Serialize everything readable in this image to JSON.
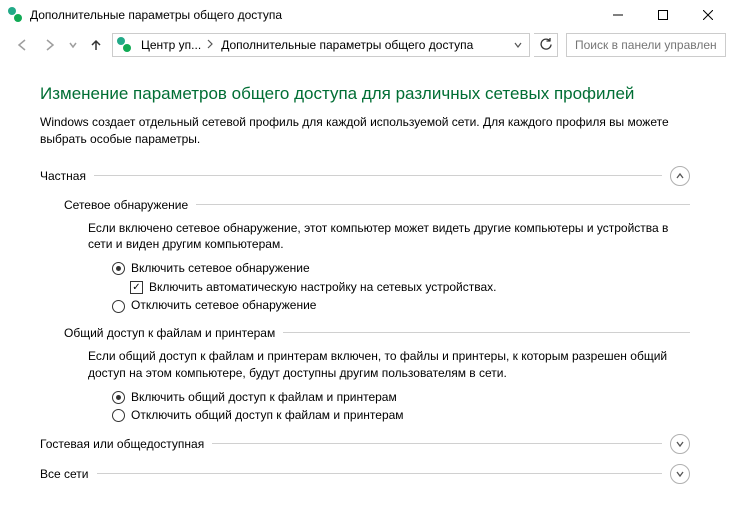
{
  "window": {
    "title": "Дополнительные параметры общего доступа"
  },
  "breadcrumb": {
    "seg1": "Центр уп...",
    "seg2": "Дополнительные параметры общего доступа"
  },
  "search": {
    "placeholder": "Поиск в панели управления"
  },
  "page": {
    "heading": "Изменение параметров общего доступа для различных сетевых профилей",
    "intro": "Windows создает отдельный сетевой профиль для каждой используемой сети. Для каждого профиля вы можете выбрать особые параметры."
  },
  "sections": {
    "private": {
      "label": "Частная",
      "expanded": true,
      "network_discovery": {
        "title": "Сетевое обнаружение",
        "desc": "Если включено сетевое обнаружение, этот компьютер может видеть другие компьютеры и устройства в сети и виден другим компьютерам.",
        "opt_on": "Включить сетевое обнаружение",
        "opt_auto": "Включить автоматическую настройку на сетевых устройствах.",
        "opt_off": "Отключить сетевое обнаружение",
        "selected": "on",
        "auto_checked": true
      },
      "file_sharing": {
        "title": "Общий доступ к файлам и принтерам",
        "desc": "Если общий доступ к файлам и принтерам включен, то файлы и принтеры, к которым разрешен общий доступ на этом компьютере, будут доступны другим пользователям в сети.",
        "opt_on": "Включить общий доступ к файлам и принтерам",
        "opt_off": "Отключить общий доступ к файлам и принтерам",
        "selected": "on"
      }
    },
    "guest": {
      "label": "Гостевая или общедоступная",
      "expanded": false
    },
    "all": {
      "label": "Все сети",
      "expanded": false
    }
  }
}
